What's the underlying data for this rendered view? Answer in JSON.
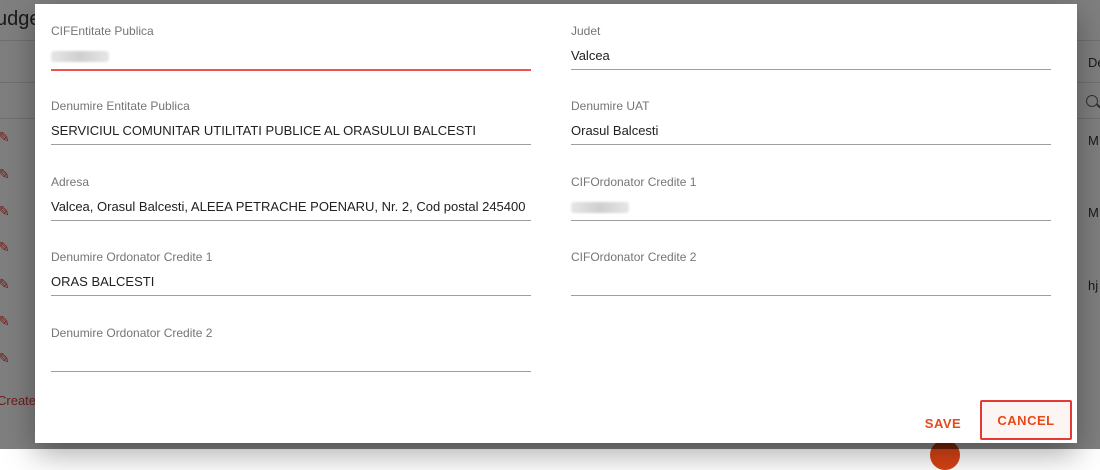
{
  "background": {
    "title": "udget",
    "create_link": "Create",
    "right_texts": [
      "De",
      "M",
      "M",
      "hj"
    ]
  },
  "dialog": {
    "fields": [
      {
        "label": "CIFEntitate Publica",
        "value": ""
      },
      {
        "label": "Judet",
        "value": "Valcea"
      },
      {
        "label": "Denumire Entitate Publica",
        "value": "SERVICIUL COMUNITAR UTILITATI PUBLICE AL ORASULUI BALCESTI"
      },
      {
        "label": "Denumire UAT",
        "value": "Orasul Balcesti"
      },
      {
        "label": "Adresa",
        "value": "Valcea, Orasul Balcesti, ALEEA PETRACHE POENARU, Nr. 2, Cod postal 245400"
      },
      {
        "label": "CIFOrdonator Credite 1",
        "value": ""
      },
      {
        "label": "Denumire Ordonator Credite 1",
        "value": "ORAS BALCESTI"
      },
      {
        "label": "CIFOrdonator Credite 2",
        "value": ""
      },
      {
        "label": "Denumire Ordonator Credite 2",
        "value": ""
      }
    ],
    "save_label": "SAVE",
    "cancel_label": "CANCEL"
  },
  "colors": {
    "accent": "#e64a19",
    "focus_underline": "#ef5350",
    "overlay": "rgba(0,0,0,0.5)"
  }
}
